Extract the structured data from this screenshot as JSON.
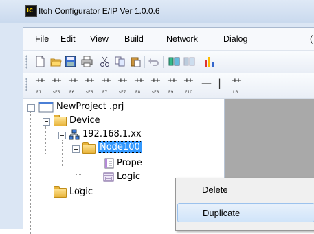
{
  "window": {
    "title": "Itoh Configurator E/IP Ver 1.0.0.6"
  },
  "menu": [
    "File",
    "Edit",
    "View",
    "Build",
    "Network",
    "Dialog",
    "("
  ],
  "toolbar": {
    "buttons": [
      "new-icon",
      "open-icon",
      "save-icon",
      "print-icon",
      "cut-icon",
      "copy-icon",
      "paste-icon",
      "undo-icon",
      "build-icon",
      "build-disabled-icon",
      "chart-icon"
    ]
  },
  "function_keys": [
    {
      "label": "F1",
      "glyph": "⺾"
    },
    {
      "label": "sF5",
      "glyph": "⺾"
    },
    {
      "label": "F6",
      "glyph": "⺾"
    },
    {
      "label": "sF6",
      "glyph": "⺾"
    },
    {
      "label": "F7",
      "glyph": "⺾"
    },
    {
      "label": "sF7",
      "glyph": "⺾"
    },
    {
      "label": "F8",
      "glyph": "⺾"
    },
    {
      "label": "sF8",
      "glyph": "⺾"
    },
    {
      "label": "F9",
      "glyph": "⺾"
    },
    {
      "label": "F10",
      "glyph": "⺾"
    },
    {
      "label": "",
      "glyph": "—"
    },
    {
      "label": "",
      "glyph": "|"
    },
    {
      "label": "LB",
      "glyph": "⺾"
    }
  ],
  "tree": {
    "project": "NewProject .prj",
    "device": "Device",
    "ip": "192.168.1.xx",
    "node": "Node100",
    "properties": "Prope",
    "logic_child": "Logic",
    "logic_folder": "Logic"
  },
  "context_menu": {
    "items": [
      "Delete",
      "Duplicate"
    ],
    "highlighted": "Duplicate"
  }
}
